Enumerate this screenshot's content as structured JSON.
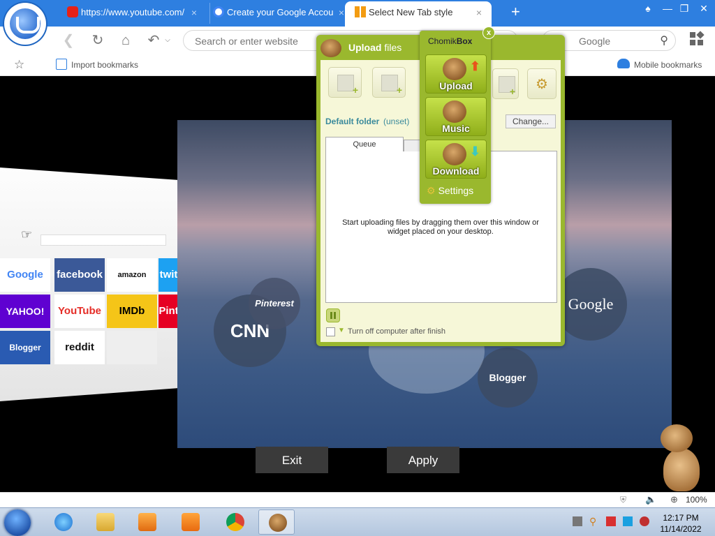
{
  "browser": {
    "tabs": [
      {
        "label": "https://www.youtube.com/",
        "favicon": "youtube-icon"
      },
      {
        "label": "Create your Google Accou",
        "favicon": "google-icon"
      },
      {
        "label": "Select New Tab style",
        "favicon": "uc-tiles-icon"
      }
    ],
    "new_tab_symbol": "+",
    "close_symbol": "×",
    "url_placeholder": "Search or enter website",
    "search_placeholder": "Google",
    "bookmarks": {
      "import_label": "Import bookmarks",
      "mobile_label": "Mobile bookmarks"
    }
  },
  "newtab_style": {
    "tiles": [
      "Google",
      "facebook",
      "amazon",
      "twit",
      "YAHOO!",
      "YouTube",
      "IMDb",
      "Pint",
      "Blogger",
      "reddit"
    ],
    "bubbles": [
      "CNN",
      "Pinterest",
      "Blogger",
      "Google"
    ],
    "exit_label": "Exit",
    "apply_label": "Apply"
  },
  "upload_window": {
    "title_bold": "Upload",
    "title_rest": "files",
    "default_folder_label": "Default folder",
    "default_folder_value": "(unset)",
    "change_label": "Change...",
    "queue_tab": "Queue",
    "queue_message": "Start uploading files by dragging them over this window or widget placed on your desktop.",
    "shutdown_label": "Turn off computer after finish"
  },
  "chomikbox": {
    "title_regular": "Chomik",
    "title_bold": "Box",
    "close_symbol": "x",
    "buttons": [
      "Upload",
      "Music",
      "Download"
    ],
    "settings_label": "Settings"
  },
  "status": {
    "zoom": "100%"
  },
  "taskbar": {
    "time": "12:17 PM",
    "date": "11/14/2022"
  },
  "colors": {
    "titlebar": "#2e7fe0",
    "chomik_green": "#9ab82e",
    "panel_cream": "#f6f7d8"
  }
}
